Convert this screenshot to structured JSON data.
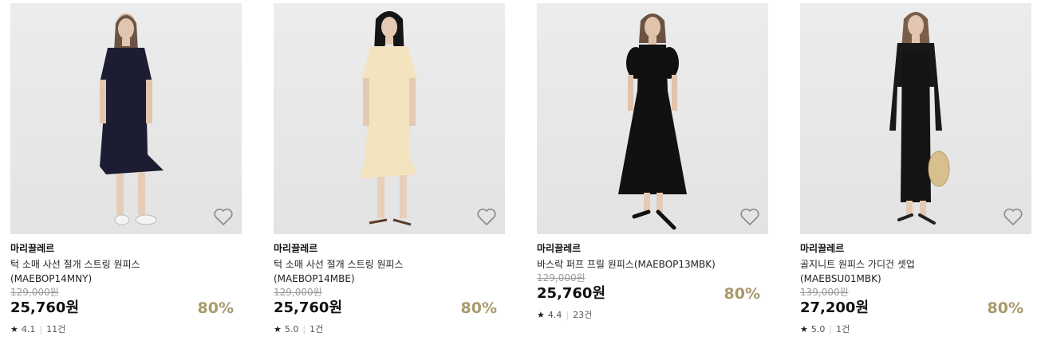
{
  "products": [
    {
      "brand": "마리끌레르",
      "name": "턱 소매 사선 절개 스트링 원피스 (MAEBOP14MNY)",
      "original_price": "129,000원",
      "price": "25,760원",
      "discount": "80%",
      "star": "★",
      "rating": "4.1",
      "reviews": "11건",
      "dress_color": "#1c1d33",
      "icon": "heart-outline-icon"
    },
    {
      "brand": "마리끌레르",
      "name": "턱 소매 사선 절개 스트링 원피스 (MAEBOP14MBE)",
      "original_price": "129,000원",
      "price": "25,760원",
      "discount": "80%",
      "star": "★",
      "rating": "5.0",
      "reviews": "1건",
      "dress_color": "#f3e4bf",
      "icon": "heart-outline-icon"
    },
    {
      "brand": "마리끌레르",
      "name": "바스락 퍼프 프릴 원피스(MAEBOP13MBK)",
      "original_price": "129,000원",
      "price": "25,760원",
      "discount": "80%",
      "star": "★",
      "rating": "4.4",
      "reviews": "23건",
      "dress_color": "#111111",
      "icon": "heart-outline-icon"
    },
    {
      "brand": "마리끌레르",
      "name": "골지니트 원피스 가디건 셋업(MAEBSU01MBK)",
      "original_price": "139,000원",
      "price": "27,200원",
      "discount": "80%",
      "star": "★",
      "rating": "5.0",
      "reviews": "1건",
      "dress_color": "#141414",
      "icon": "heart-outline-icon"
    }
  ],
  "colors": {
    "discount": "#a89a6c",
    "original_price": "#9a9a9a",
    "background": "#ececec"
  }
}
